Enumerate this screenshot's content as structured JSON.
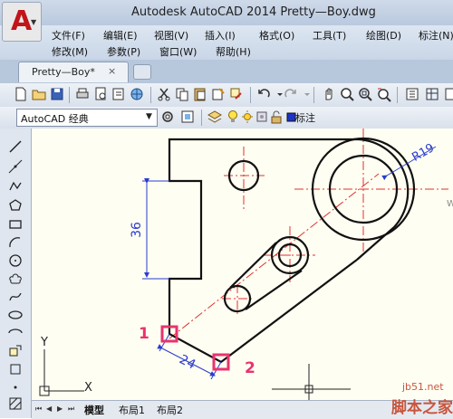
{
  "title": "Autodesk AutoCAD 2014     Pretty—Boy.dwg",
  "menu_row1": [
    "文件(F)",
    "编辑(E)",
    "视图(V)",
    "插入(I)",
    "格式(O)",
    "工具(T)",
    "绘图(D)",
    "标注(N)"
  ],
  "menu_row2": [
    "修改(M)",
    "参数(P)",
    "窗口(W)",
    "帮助(H)"
  ],
  "doc_tab": {
    "label": "Pretty—Boy*",
    "close": "×"
  },
  "workspace": {
    "value": "AutoCAD 经典"
  },
  "layer_label": "标注",
  "drawing": {
    "dim_vertical": "36",
    "dim_aligned": "24",
    "dim_radius": "R19",
    "marker_1": "1",
    "marker_2": "2",
    "axis_y": "Y",
    "axis_x": "X",
    "edge_w": "W"
  },
  "layout_tabs": [
    "模型",
    "布局1",
    "布局2"
  ],
  "watermark": {
    "line1": "jb51.net",
    "line2": "脚本之家"
  },
  "colors": {
    "accent_marker": "#e8336f",
    "dimension": "#2a3ccf",
    "centerline": "#e03030",
    "canvas": "#fffef2"
  }
}
